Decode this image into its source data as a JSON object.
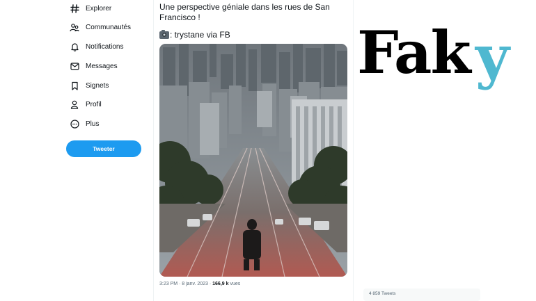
{
  "nav": {
    "items": [
      {
        "label": "Explorer",
        "icon": "hashtag-icon"
      },
      {
        "label": "Communautés",
        "icon": "communities-icon"
      },
      {
        "label": "Notifications",
        "icon": "bell-icon"
      },
      {
        "label": "Messages",
        "icon": "envelope-icon"
      },
      {
        "label": "Signets",
        "icon": "bookmark-icon"
      },
      {
        "label": "Profil",
        "icon": "person-icon"
      },
      {
        "label": "Plus",
        "icon": "more-circle-icon"
      }
    ],
    "tweet_button": "Tweeter"
  },
  "tweet": {
    "text": "Une perspective géniale dans les rues de San Francisco !",
    "credit": ": trystane via FB",
    "time": "3:23 PM · 8 janv. 2023 · ",
    "views_count": "166,9 k",
    "views_label": " vues"
  },
  "brand": {
    "logo_main": "Fak",
    "logo_accent": "y",
    "accent_color": "#4fb8d0"
  },
  "side": {
    "tweets_count": "4 859 Tweets"
  },
  "colors": {
    "accent": "#1d9bf0",
    "text": "#0f1419",
    "secondary": "#536471"
  }
}
